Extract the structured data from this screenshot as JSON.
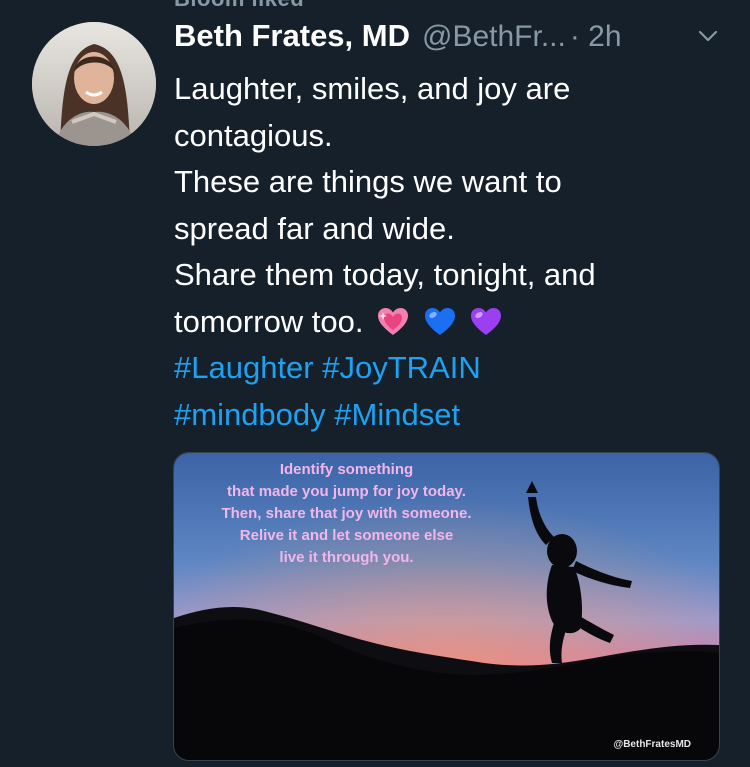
{
  "banner": {
    "text": "Bloom liked"
  },
  "tweet": {
    "author_name": "Beth Frates, MD",
    "handle": "@BethFr...",
    "separator_time": "· 2h",
    "text_lines": [
      "Laughter, smiles, and joy are",
      "contagious.",
      "These are things we want to",
      "spread far and wide.",
      "Share them today, tonight, and",
      "tomorrow too."
    ],
    "emojis": [
      "sparkling-heart",
      "blue-heart",
      "purple-heart"
    ],
    "hashtag_lines": [
      "#Laughter #JoyTRAIN",
      "#mindbody #Mindset"
    ]
  },
  "media": {
    "quote_lines": [
      "Identify something",
      "that made you jump for joy today.",
      "Then, share that joy with someone.",
      "Relive it and let someone else",
      "live it through you."
    ],
    "watermark": "@BethFratesMD"
  },
  "colors": {
    "background": "#15202b",
    "secondary_text": "#8899a6",
    "link": "#1da1f2"
  }
}
